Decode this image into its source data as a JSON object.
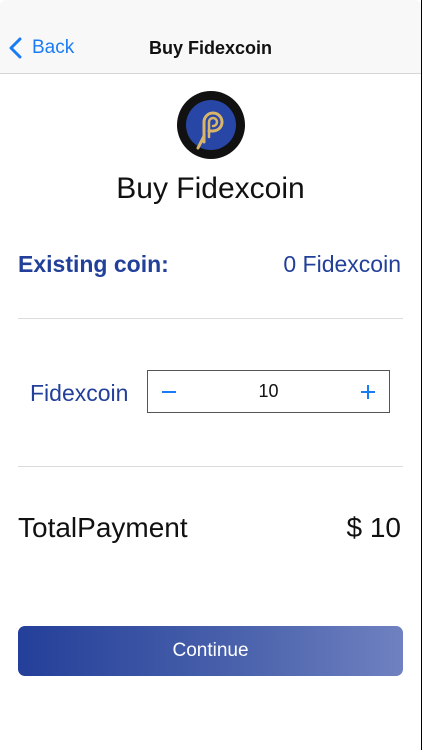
{
  "navbar": {
    "back_label": "Back",
    "title": "Buy Fidexcoin"
  },
  "logo": {
    "icon": "fidexcoin-logo-icon",
    "ring_color": "#111111",
    "inner_color": "#2846a6",
    "mark_color": "#d9b56a"
  },
  "main": {
    "title": "Buy Fidexcoin",
    "existing_label": "Existing coin:",
    "existing_value": "0 Fidexcoin",
    "coin_label": "Fidexcoin",
    "quantity": "10",
    "total_label": "TotalPayment",
    "total_value": "$ 10"
  },
  "actions": {
    "continue_label": "Continue"
  },
  "colors": {
    "accent": "#22409a",
    "link": "#1a7cf5"
  }
}
